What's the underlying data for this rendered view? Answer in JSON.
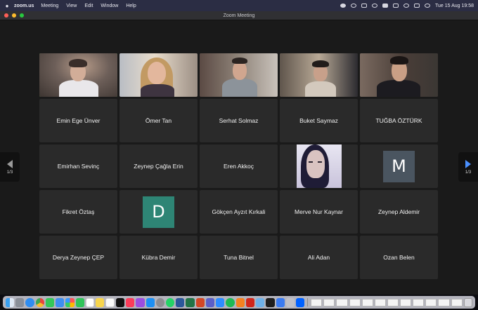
{
  "menubar": {
    "app_name": "zoom.us",
    "items": [
      "Meeting",
      "View",
      "Edit",
      "Window",
      "Help"
    ],
    "clock": "Tue 15 Aug  19:58"
  },
  "window": {
    "title": "Zoom Meeting"
  },
  "pager": {
    "left_label": "1/3",
    "right_label": "1/3"
  },
  "video_tiles": [
    {
      "scene": "s1",
      "active": true
    },
    {
      "scene": "s2"
    },
    {
      "scene": "s3"
    },
    {
      "scene": "s4"
    },
    {
      "scene": "s5"
    }
  ],
  "participants": [
    {
      "name": "Emin Ege Ünver"
    },
    {
      "name": "Ömer Tan"
    },
    {
      "name": "Serhat Solmaz"
    },
    {
      "name": "Buket Saymaz"
    },
    {
      "name": "TUĞBA ÖZTÜRK"
    },
    {
      "name": "Emirhan Sevinç"
    },
    {
      "name": "Zeynep Çağla Erin"
    },
    {
      "name": "Eren Akkoç"
    },
    {
      "avatar": "photo"
    },
    {
      "avatar_letter": "M",
      "color": "#4a5560"
    },
    {
      "name": "Fikret Öztaş"
    },
    {
      "avatar_letter": "D",
      "color": "#2e8575"
    },
    {
      "name": "Gökçen Ayzıt Kırkali"
    },
    {
      "name": "Merve Nur Kaynar"
    },
    {
      "name": "Zeynep Aldemir"
    },
    {
      "name": "Derya Zeynep ÇEP"
    },
    {
      "name": "Kübra Demir"
    },
    {
      "name": "Tuna Bitnel"
    },
    {
      "name": "Ali Adan"
    },
    {
      "name": "Ozan Belen"
    }
  ],
  "colors": {
    "active_speaker": "#3ed84a",
    "tile_bg": "#2a2a2a",
    "next_arrow": "#4a90ff"
  }
}
